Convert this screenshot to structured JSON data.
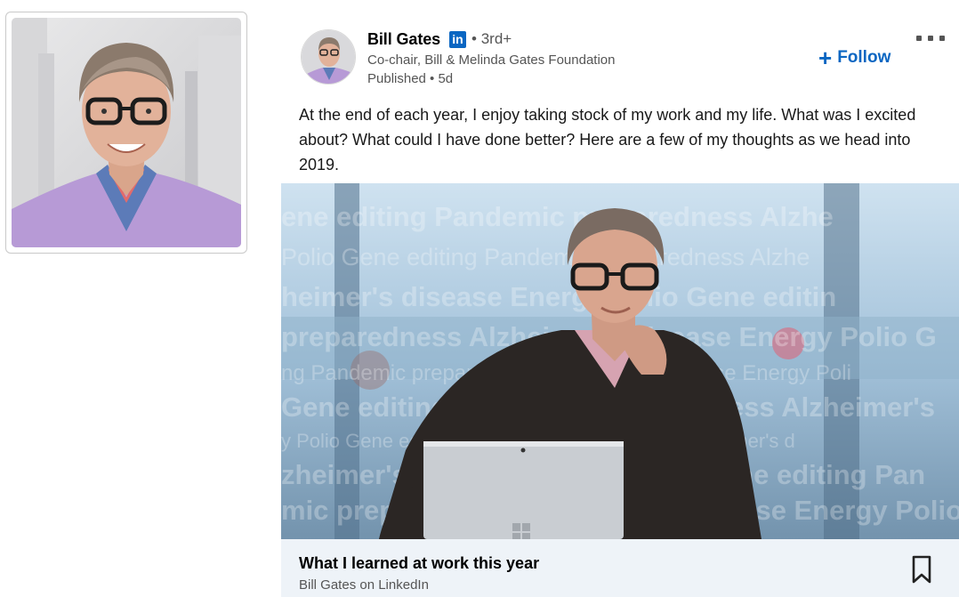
{
  "post": {
    "author": {
      "name": "Bill Gates",
      "linkedin_badge": "in",
      "degree": "• 3rd+",
      "headline": "Co-chair, Bill & Melinda Gates Foundation",
      "published": "Published • 5d"
    },
    "follow_label": "Follow",
    "follow_icon": "plus-icon",
    "more_icon": "more-options-icon",
    "text": "At the end of each year, I enjoy taking stock of my work and my life. What was I excited about? What could I have done better? Here are a few of my thoughts as we head into 2019."
  },
  "article": {
    "overlay_words": [
      "ene editing  Pandemic preparedness  Alzhe",
      "Polio  Gene editing  Pandemic preparedness  Alzhe",
      "heimer's disease  Energy  Polio  Gene editin",
      "preparedness  Alzheimer's disease  Energy  Polio  G",
      "ng  Pandemic preparedness  Alzheimer's disease  Energy  Poli",
      "Gene editing  Pandemic preparedness  Alzheimer's",
      "y  Polio  Gene editing  Pandemic preparedness  Alzheimer's d",
      "zheimer's disease  Energy  Polio  Gene editing  Pan",
      "mic preparedness  Alzheimer's disease  Energy  Polio"
    ],
    "title": "What I learned at work this year",
    "source": "Bill Gates on LinkedIn",
    "bookmark_icon": "bookmark-icon"
  },
  "colors": {
    "linkedin_blue": "#0a66c2",
    "footer_bg": "#eef3f8",
    "sweater_purple": "#b79ad6"
  }
}
